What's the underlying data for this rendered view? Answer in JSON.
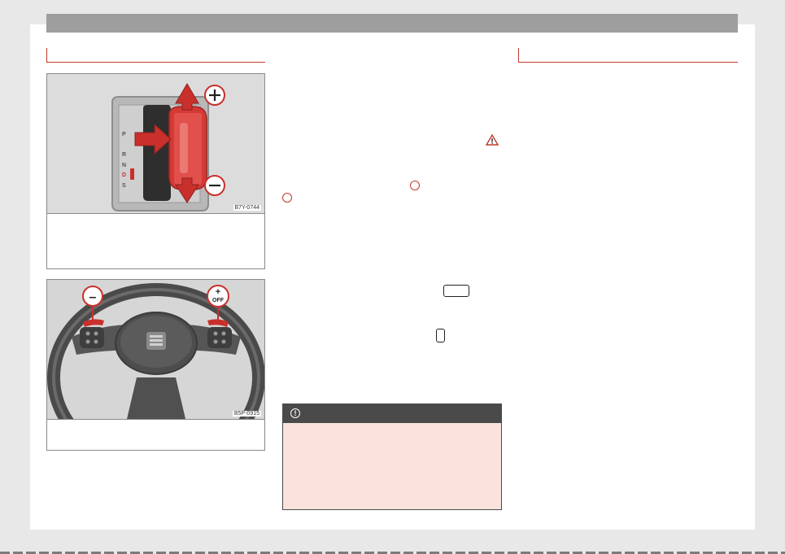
{
  "figures": [
    {
      "code": "B7Y-0744",
      "plus_icon": "plus-circle-icon",
      "minus_icon": "minus-circle-icon"
    },
    {
      "code": "B5P-0915",
      "minus_label": "–",
      "plus_label": "+",
      "off_label": "OFF"
    }
  ],
  "gear_positions": [
    "P",
    "R",
    "N",
    "D",
    "S"
  ],
  "colors": {
    "accent": "#c0392b",
    "arrow": "#c9302c",
    "notice_bg": "#fae3dc",
    "notice_head": "#4a4a4a",
    "topbar": "#9e9e9e"
  },
  "notice": {
    "icon": "notice-icon"
  }
}
